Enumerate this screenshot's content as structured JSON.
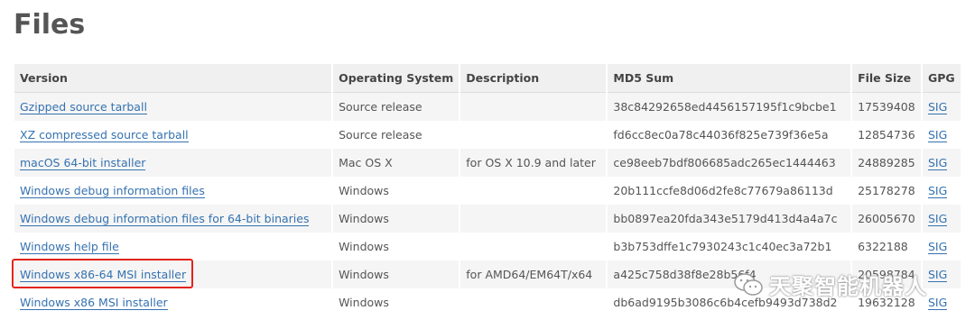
{
  "page": {
    "title": "Files"
  },
  "table": {
    "headers": {
      "version": "Version",
      "os": "Operating System",
      "description": "Description",
      "md5": "MD5 Sum",
      "size": "File Size",
      "gpg": "GPG"
    },
    "rows": [
      {
        "version": "Gzipped source tarball",
        "os": "Source release",
        "description": "",
        "md5": "38c84292658ed4456157195f1c9bcbe1",
        "size": "17539408",
        "gpg": "SIG"
      },
      {
        "version": "XZ compressed source tarball",
        "os": "Source release",
        "description": "",
        "md5": "fd6cc8ec0a78c44036f825e739f36e5a",
        "size": "12854736",
        "gpg": "SIG"
      },
      {
        "version": "macOS 64-bit installer",
        "os": "Mac OS X",
        "description": "for OS X 10.9 and later",
        "md5": "ce98eeb7bdf806685adc265ec1444463",
        "size": "24889285",
        "gpg": "SIG"
      },
      {
        "version": "Windows debug information files",
        "os": "Windows",
        "description": "",
        "md5": "20b111ccfe8d06d2fe8c77679a86113d",
        "size": "25178278",
        "gpg": "SIG"
      },
      {
        "version": "Windows debug information files for 64-bit binaries",
        "os": "Windows",
        "description": "",
        "md5": "bb0897ea20fda343e5179d413d4a4a7c",
        "size": "26005670",
        "gpg": "SIG"
      },
      {
        "version": "Windows help file",
        "os": "Windows",
        "description": "",
        "md5": "b3b753dffe1c7930243c1c40ec3a72b1",
        "size": "6322188",
        "gpg": "SIG"
      },
      {
        "version": "Windows x86-64 MSI installer",
        "os": "Windows",
        "description": "for AMD64/EM64T/x64",
        "md5": "a425c758d38f8e28b56f4",
        "size": "20598784",
        "gpg": "SIG"
      },
      {
        "version": "Windows x86 MSI installer",
        "os": "Windows",
        "description": "",
        "md5": "db6ad9195b3086c6b4cefb9493d738d2",
        "size": "19632128",
        "gpg": "SIG"
      }
    ]
  },
  "watermark": {
    "text": "天聚智能机器人",
    "icon": "wechat-icon"
  },
  "colors": {
    "link": "#3572b0",
    "highlight": "#e2231a",
    "header_bg": "#f0f0f0",
    "stripe_bg": "#f5f5f5"
  }
}
